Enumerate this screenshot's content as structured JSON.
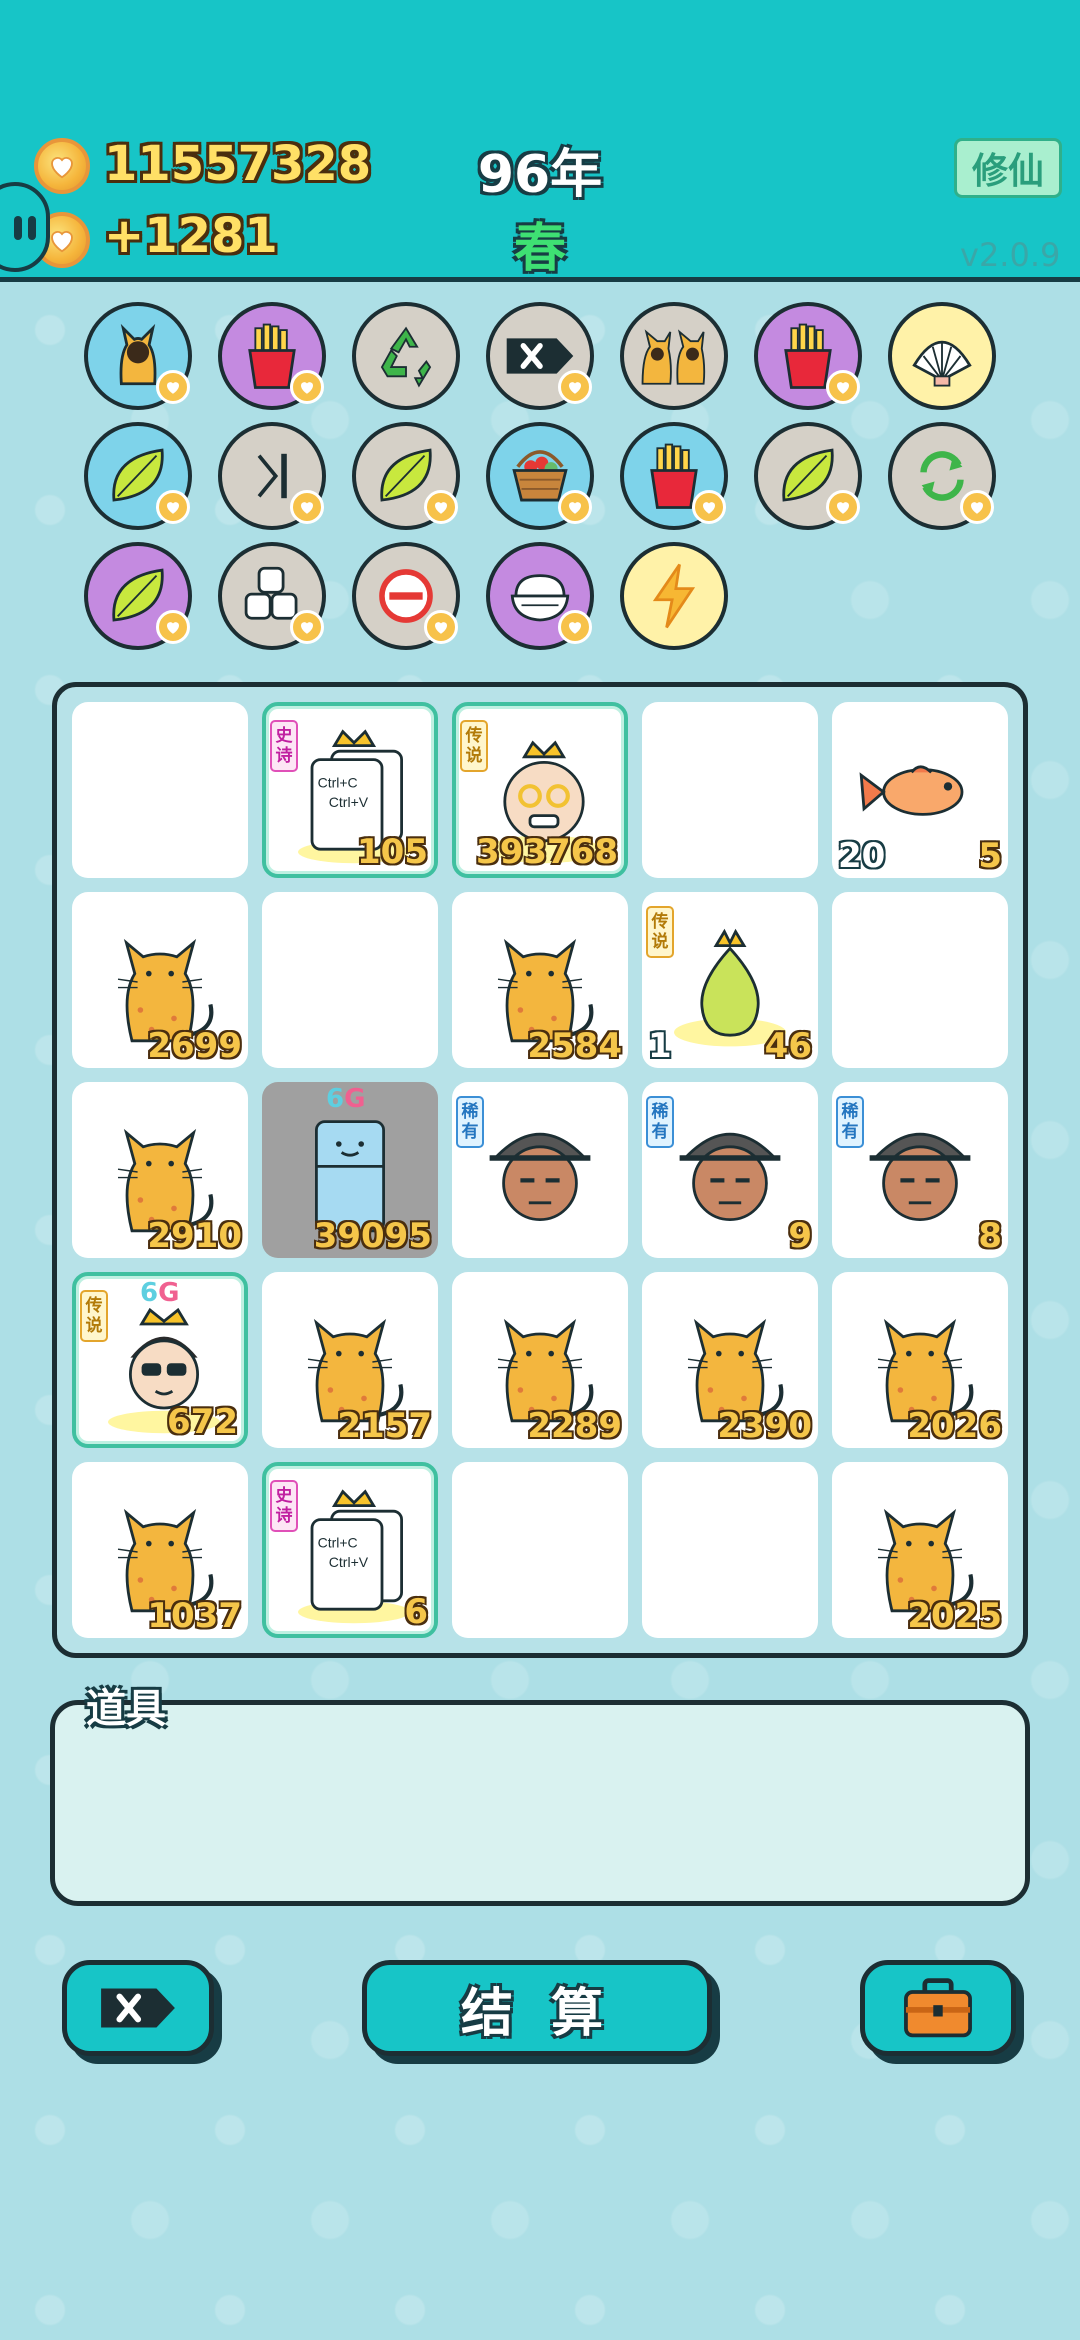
{
  "header": {
    "coins": "11557328",
    "income": "+1281",
    "year": "96年",
    "season": "春",
    "xiuxian_label": "修仙",
    "version": "v2.0.9"
  },
  "symbols": [
    {
      "icon": "cat-back-icon",
      "bg": "blue"
    },
    {
      "icon": "fries-icon",
      "bg": "purple"
    },
    {
      "icon": "recycle-icon",
      "bg": "gray"
    },
    {
      "icon": "delete-tag-icon",
      "bg": "gray"
    },
    {
      "icon": "cat-pair-icon",
      "bg": "gray"
    },
    {
      "icon": "fries-icon",
      "bg": "purple"
    },
    {
      "icon": "shell-icon",
      "bg": "yellow"
    },
    {
      "icon": "leaf-icon",
      "bg": "blue"
    },
    {
      "icon": "skip-icon",
      "bg": "gray"
    },
    {
      "icon": "leaf-icon",
      "bg": "gray"
    },
    {
      "icon": "fruit-basket-icon",
      "bg": "blue"
    },
    {
      "icon": "fries-icon",
      "bg": "blue"
    },
    {
      "icon": "leaf-icon",
      "bg": "gray"
    },
    {
      "icon": "refresh-icon",
      "bg": "gray"
    },
    {
      "icon": "leaf-icon",
      "bg": "purple"
    },
    {
      "icon": "sugar-cubes-icon",
      "bg": "gray"
    },
    {
      "icon": "no-entry-icon",
      "bg": "gray"
    },
    {
      "icon": "rice-bowl-icon",
      "bg": "purple"
    },
    {
      "icon": "lightning-icon",
      "bg": "yellow"
    }
  ],
  "grid": [
    {
      "type": "empty"
    },
    {
      "type": "ctrlcv",
      "tag": "史诗",
      "value": "105",
      "line1": "Ctrl+C",
      "line2": "Ctrl+V"
    },
    {
      "type": "grandpa",
      "tag": "传说",
      "value": "393768"
    },
    {
      "type": "empty"
    },
    {
      "type": "fish",
      "left": "20",
      "value": "5"
    },
    {
      "type": "cat",
      "value": "2699"
    },
    {
      "type": "empty"
    },
    {
      "type": "cat",
      "value": "2584"
    },
    {
      "type": "pear",
      "tag": "传说",
      "left": "1",
      "value": "46"
    },
    {
      "type": "empty"
    },
    {
      "type": "cat",
      "value": "2910"
    },
    {
      "type": "fridge",
      "value": "39095",
      "badge6": "6",
      "badgeG": "G"
    },
    {
      "type": "hat-man",
      "tag": "稀有",
      "value": ""
    },
    {
      "type": "hat-man",
      "tag": "稀有",
      "value": "9"
    },
    {
      "type": "hat-man",
      "tag": "稀有",
      "value": "8"
    },
    {
      "type": "sunglass-man",
      "tag": "传说",
      "value": "672",
      "badge6": "6",
      "badgeG": "G"
    },
    {
      "type": "cat",
      "value": "2157"
    },
    {
      "type": "cat",
      "value": "2289"
    },
    {
      "type": "cat",
      "value": "2390"
    },
    {
      "type": "cat",
      "value": "2026"
    },
    {
      "type": "cat",
      "value": "1037"
    },
    {
      "type": "ctrlcv",
      "tag": "史诗",
      "value": "6",
      "line1": "Ctrl+C",
      "line2": "Ctrl+V"
    },
    {
      "type": "empty"
    },
    {
      "type": "empty"
    },
    {
      "type": "cat",
      "value": "2025"
    }
  ],
  "items": {
    "label": "道具"
  },
  "buttons": {
    "remove_icon": "delete-tag-icon",
    "settle_label": "结 算",
    "bag_icon": "briefcase-icon"
  }
}
